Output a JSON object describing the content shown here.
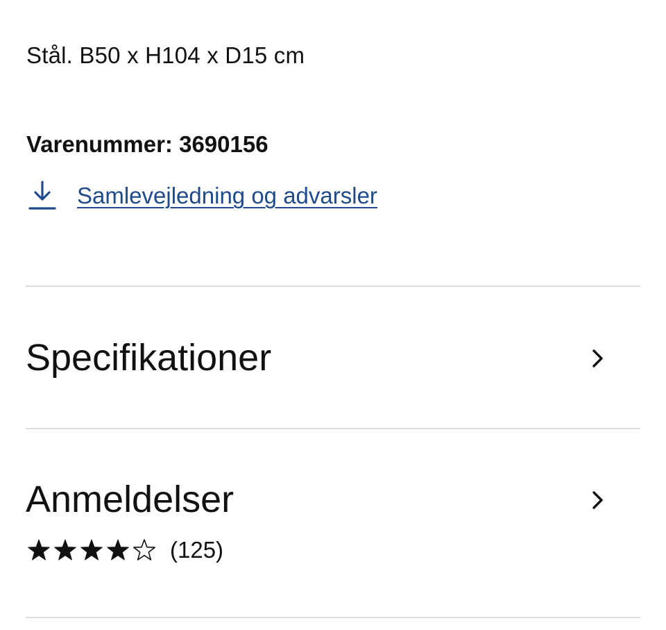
{
  "product": {
    "description": "Stål. B50 x H104 x D15 cm",
    "article_number": "Varenummer: 3690156"
  },
  "assembly_link": {
    "label": "Samlevejledning og advarsler",
    "icon": "download-icon"
  },
  "sections": {
    "specifications": {
      "title": "Specifikationer",
      "icon": "chevron-right-icon"
    },
    "reviews": {
      "title": "Anmeldelser",
      "icon": "chevron-right-icon",
      "rating": 4,
      "rating_max": 5,
      "count": "(125)"
    }
  },
  "colors": {
    "link": "#1f4a8c",
    "text": "#111111",
    "divider": "#dcdcdc",
    "star_filled": "#111111",
    "star_empty": "#111111"
  }
}
